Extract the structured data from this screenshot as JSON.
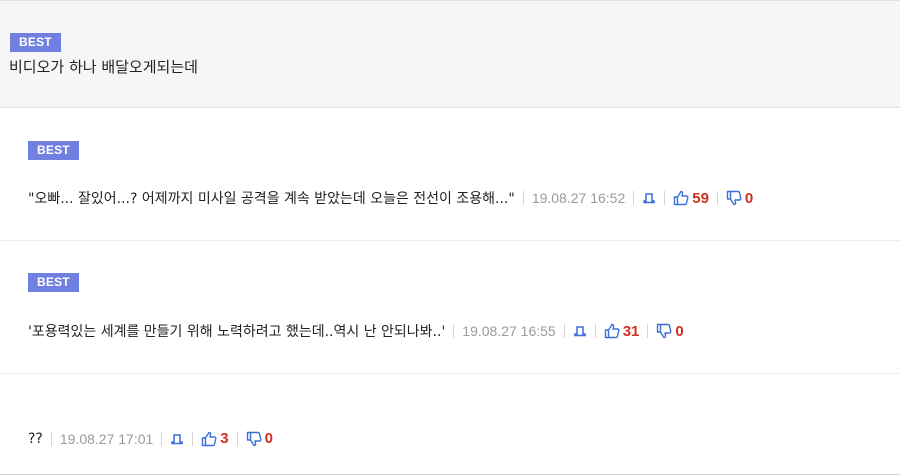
{
  "top_comment": {
    "badge": "BEST",
    "text": "비디오가 하나 배달오게되는데"
  },
  "replies": [
    {
      "badge": "BEST",
      "text": "\"오빠... 잘있어...? 어제까지 미사일 공격을 계속 받았는데 오늘은 전선이 조용해...\"",
      "date": "19.08.27 16:52",
      "report_icon": "bell-icon",
      "upvotes": "59",
      "downvotes": "0"
    },
    {
      "badge": "BEST",
      "text": "'포용력있는 세계를 만들기 위해 노력하려고 했는데..역시 난 안되나봐..'",
      "date": "19.08.27 16:55",
      "report_icon": "bell-icon",
      "upvotes": "31",
      "downvotes": "0"
    },
    {
      "text": "??",
      "date": "19.08.27 17:01",
      "report_icon": "bell-icon",
      "upvotes": "3",
      "downvotes": "0"
    }
  ],
  "colors": {
    "badge_bg": "#7080e0",
    "vote_icon": "#3a6fd8",
    "count": "#d03020",
    "date": "#9a9a9a"
  }
}
